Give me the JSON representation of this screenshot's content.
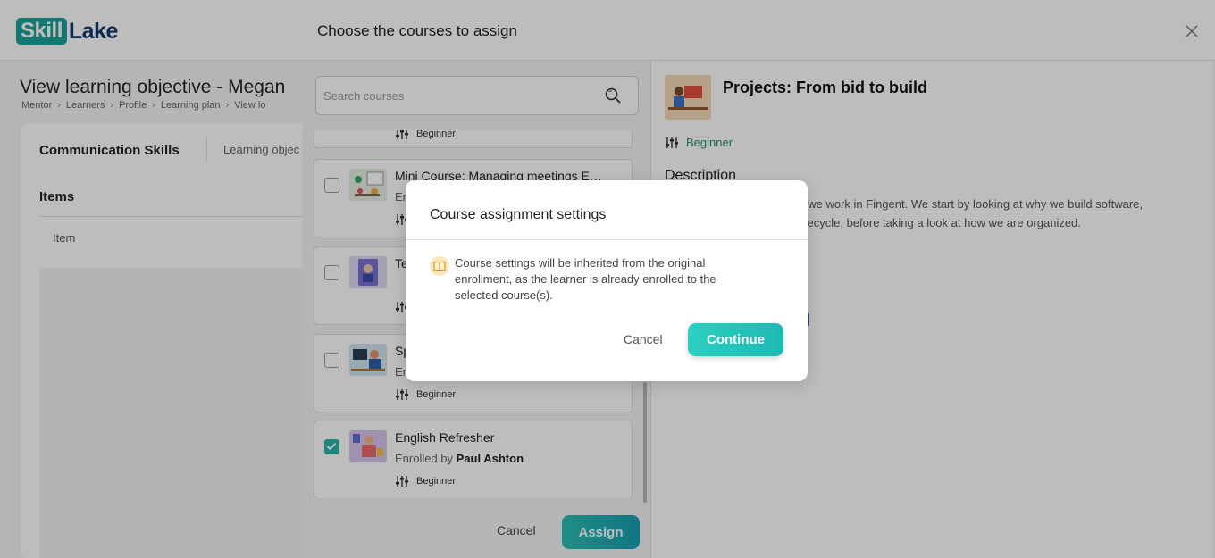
{
  "app": {
    "logo_left": "Skill",
    "logo_right": "Lake"
  },
  "page": {
    "title": "View learning objective - Megan",
    "breadcrumb": [
      "Mentor",
      "Learners",
      "Profile",
      "Learning plan",
      "View lo"
    ],
    "card_title": "Communication Skills",
    "card_tab": "Learning objec",
    "items_title": "Items",
    "item_label": "Item"
  },
  "drawer": {
    "title": "Choose the courses to assign",
    "search_placeholder": "Search courses",
    "courses": [
      {
        "title": "",
        "sub_prefix": "",
        "sub_name": "",
        "level": "Beginner",
        "checked": false
      },
      {
        "title": "Mini Course: Managing meetings E…",
        "sub_prefix": "En",
        "sub_name": "",
        "level": "",
        "checked": false
      },
      {
        "title": "Te",
        "sub_prefix": "",
        "sub_name": "",
        "level": "",
        "checked": false
      },
      {
        "title": "Sp",
        "sub_prefix": "En",
        "sub_name": "",
        "level": "Beginner",
        "checked": false
      },
      {
        "title": "English Refresher",
        "sub_prefix": "Enrolled by ",
        "sub_name": "Paul Ashton",
        "level": "Beginner",
        "checked": true
      }
    ],
    "cancel_label": "Cancel",
    "assign_label": "Assign",
    "detail": {
      "title": "Projects: From bid to build",
      "level": "Beginner",
      "desc_title": "Description",
      "desc_line1": "ow we work in Fingent. We start by looking at why we build software,",
      "desc_line2": "s lifecycle, before taking a look at how we are organized."
    }
  },
  "modal": {
    "title": "Course assignment settings",
    "message": "Course settings will be inherited from the original enrollment, as the learner is already enrolled to the selected course(s).",
    "cancel_label": "Cancel",
    "continue_label": "Continue"
  },
  "colors": {
    "accent": "#2bc0b4",
    "brand_dark": "#16386b",
    "level_green": "#2b8f73"
  }
}
